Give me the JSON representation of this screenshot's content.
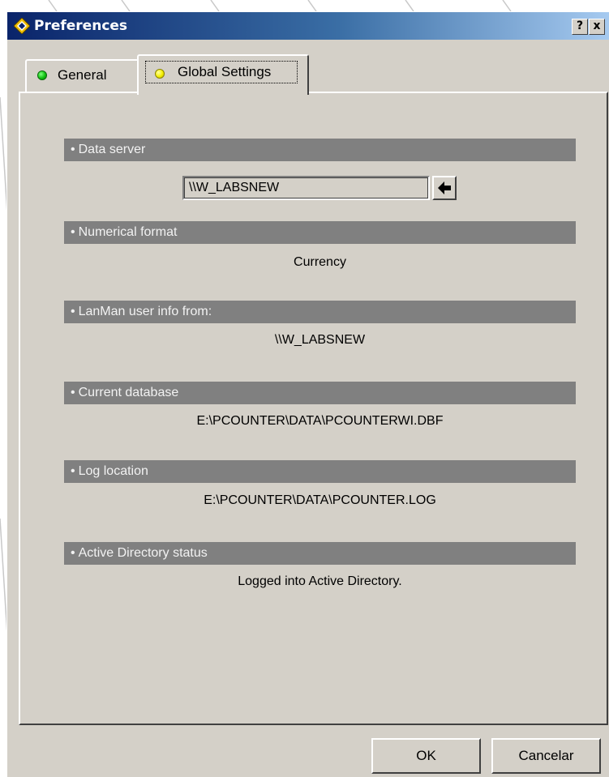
{
  "window": {
    "title": "Preferences",
    "help_button": "?",
    "close_button": "x"
  },
  "tabs": [
    {
      "label": "General",
      "status_color": "green",
      "selected": false
    },
    {
      "label": "Global Settings",
      "status_color": "yellow",
      "selected": true
    }
  ],
  "sections": {
    "data_server": {
      "header": "Data server",
      "value": "\\\\W_LABSNEW"
    },
    "numerical_format": {
      "header": "Numerical format",
      "value": "Currency"
    },
    "lanman": {
      "header": "LanMan user info from:",
      "value": "\\\\W_LABSNEW"
    },
    "current_database": {
      "header": "Current database",
      "value": "E:\\PCOUNTER\\DATA\\PCOUNTERWI.DBF"
    },
    "log_location": {
      "header": "Log location",
      "value": "E:\\PCOUNTER\\DATA\\PCOUNTER.LOG"
    },
    "active_directory": {
      "header": "Active Directory status",
      "value": "Logged into Active Directory."
    }
  },
  "buttons": {
    "ok": "OK",
    "cancel": "Cancelar"
  },
  "colors": {
    "titlebar_start": "#0a246a",
    "titlebar_end": "#a6caf0",
    "dialog_face": "#d4d0c8",
    "section_header": "#808080"
  }
}
